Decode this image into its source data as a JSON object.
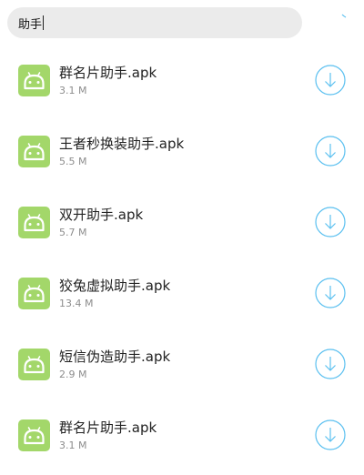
{
  "search": {
    "query": "助手"
  },
  "files": [
    {
      "name": "群名片助手.apk",
      "size": "3.1 M"
    },
    {
      "name": "王者秒换装助手.apk",
      "size": "5.5 M"
    },
    {
      "name": "双开助手.apk",
      "size": "5.7 M"
    },
    {
      "name": "狡兔虚拟助手.apk",
      "size": "13.4 M"
    },
    {
      "name": "短信伪造助手.apk",
      "size": "2.9 M"
    },
    {
      "name": "群名片助手.apk",
      "size": "3.1 M"
    }
  ],
  "icons": {
    "file_icon": "android-icon",
    "action_icon": "download-icon",
    "loading_icon": "loading-spinner-icon"
  },
  "colors": {
    "icon_bg": "#a3d76a",
    "accent": "#5bc0f0",
    "search_bg": "#ebebeb"
  }
}
